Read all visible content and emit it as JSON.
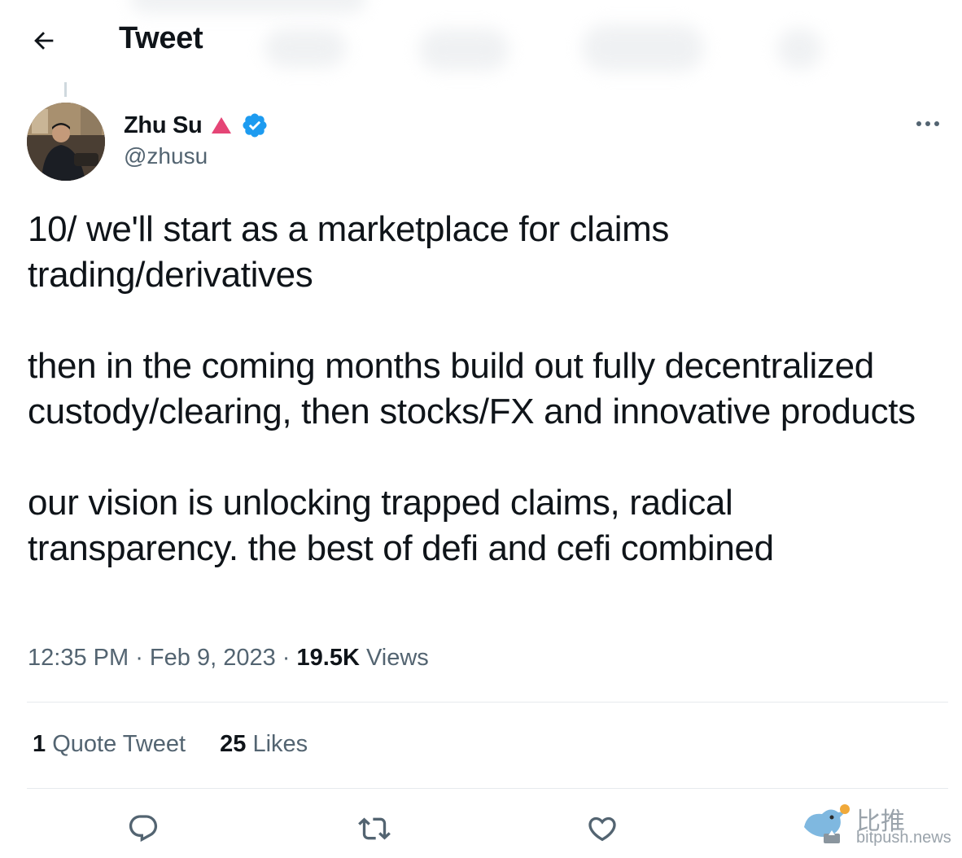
{
  "header": {
    "title": "Tweet",
    "back_icon": "arrow-left-icon"
  },
  "author": {
    "display_name": "Zhu Su",
    "handle": "@zhusu",
    "badge_colors": {
      "triangle": "#e0245e",
      "verified": "#1d9bf0"
    }
  },
  "tweet": {
    "paragraphs": [
      "10/ we'll start as a marketplace for claims trading/derivatives",
      "then in the coming months build out fully decentralized custody/clearing, then stocks/FX and innovative products",
      "our vision is unlocking trapped claims, radical transparency. the best of defi and cefi combined"
    ],
    "time": "12:35 PM",
    "date": "Feb 9, 2023",
    "views_count": "19.5K",
    "views_label": "Views"
  },
  "stats": {
    "quote_count": "1",
    "quote_label": "Quote Tweet",
    "likes_count": "25",
    "likes_label": "Likes"
  },
  "actions": [
    "reply-icon",
    "retweet-icon",
    "like-icon"
  ],
  "watermark": {
    "chinese": "比推",
    "domain": "bitpush.news"
  },
  "colors": {
    "text": "#0f1419",
    "secondary": "#536471",
    "divider": "#e6eaed"
  }
}
